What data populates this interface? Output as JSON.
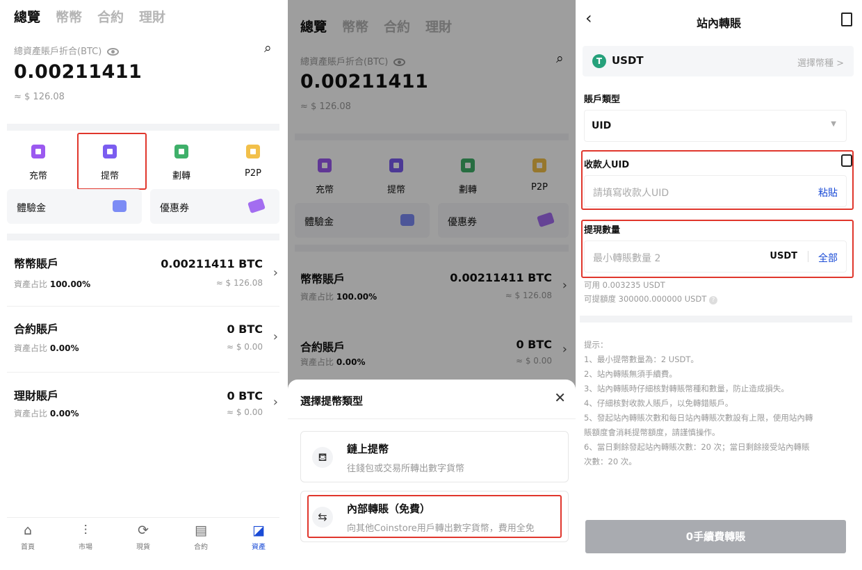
{
  "assets": {
    "tabs": [
      "總覽",
      "幣幣",
      "合約",
      "理財"
    ],
    "total_label": "總資產賬戶折合(BTC)",
    "total_btc": "0.00211411",
    "total_usd": "≈ $ 126.08",
    "actions": [
      {
        "label": "充幣",
        "icon": "deposit-icon",
        "color": "#9b59f0"
      },
      {
        "label": "提幣",
        "icon": "withdraw-icon",
        "color": "#7b5df0"
      },
      {
        "label": "劃轉",
        "icon": "transfer-icon",
        "color": "#3fb06a"
      },
      {
        "label": "P2P",
        "icon": "p2p-icon",
        "color": "#f2c04a"
      }
    ],
    "cards": [
      {
        "label": "體驗金",
        "icon": "wallet-icon",
        "color": "#7c8cf5"
      },
      {
        "label": "優惠券",
        "icon": "coupon-icon",
        "color": "#a36df0"
      }
    ],
    "accounts": [
      {
        "name": "幣幣賬戶",
        "share_label": "資產占比",
        "share": "100.00%",
        "btc": "0.00211411 BTC",
        "usd": "≈ $ 126.08"
      },
      {
        "name": "合約賬戶",
        "share_label": "資產占比",
        "share": "0.00%",
        "btc": "0 BTC",
        "usd": "≈ $ 0.00"
      },
      {
        "name": "理財賬戶",
        "share_label": "資產占比",
        "share": "0.00%",
        "btc": "0 BTC",
        "usd": "≈ $ 0.00"
      }
    ],
    "nav": [
      {
        "label": "首頁",
        "icon": "home-icon",
        "glyph": "⌂"
      },
      {
        "label": "市場",
        "icon": "market-icon",
        "glyph": "⫶"
      },
      {
        "label": "現貨",
        "icon": "spot-icon",
        "glyph": "⟳"
      },
      {
        "label": "合約",
        "icon": "contract-icon",
        "glyph": "▤"
      },
      {
        "label": "資產",
        "icon": "assets-icon",
        "glyph": "◪"
      }
    ]
  },
  "sheet": {
    "title": "選擇提幣類型",
    "options": [
      {
        "title": "鏈上提幣",
        "desc": "往錢包或交易所轉出數字貨幣",
        "icon": "chain-wallet-icon",
        "glyph": "⛾"
      },
      {
        "title": "內部轉賬（免費）",
        "desc": "向其他Coinstore用戶轉出數字貨幣，費用全免",
        "icon": "internal-transfer-icon",
        "glyph": "⇆"
      }
    ]
  },
  "transfer": {
    "title": "站內轉賬",
    "coin": "USDT",
    "coin_select": "選擇幣種 >",
    "account_type_label": "賬戶類型",
    "account_type_value": "UID",
    "recipient_label": "收款人UID",
    "recipient_placeholder": "請填寫收款人UID",
    "paste_label": "粘貼",
    "amount_label": "提現數量",
    "amount_placeholder": "最小轉賬數量 2",
    "amount_unit": "USDT",
    "all_label": "全部",
    "available": "可用 0.003235 USDT",
    "limit": "可提額度 300000.000000 USDT",
    "tips_title": "提示：",
    "tips": [
      "1、最小提幣數量為：2 USDT。",
      "2、站內轉賬無須手續費。",
      "3、站內轉賬時仔細核對轉賬幣種和數量，防止造成損失。",
      "4、仔細核對收款人賬戶，以免轉錯賬戶。",
      "5、發起站內轉賬次數和每日站內轉賬次數設有上限，使用站內轉",
      "賬額度會消耗提幣額度，請謹慎操作。",
      "6、當日剩餘發起站內轉賬次數：20 次；當日剩餘接受站內轉賬",
      "次數：20 次。"
    ],
    "submit": "0手續費轉賬",
    "colors": {
      "accent": "#1a4bd6",
      "tether": "#26a17b",
      "highlight": "#e0362c"
    }
  }
}
